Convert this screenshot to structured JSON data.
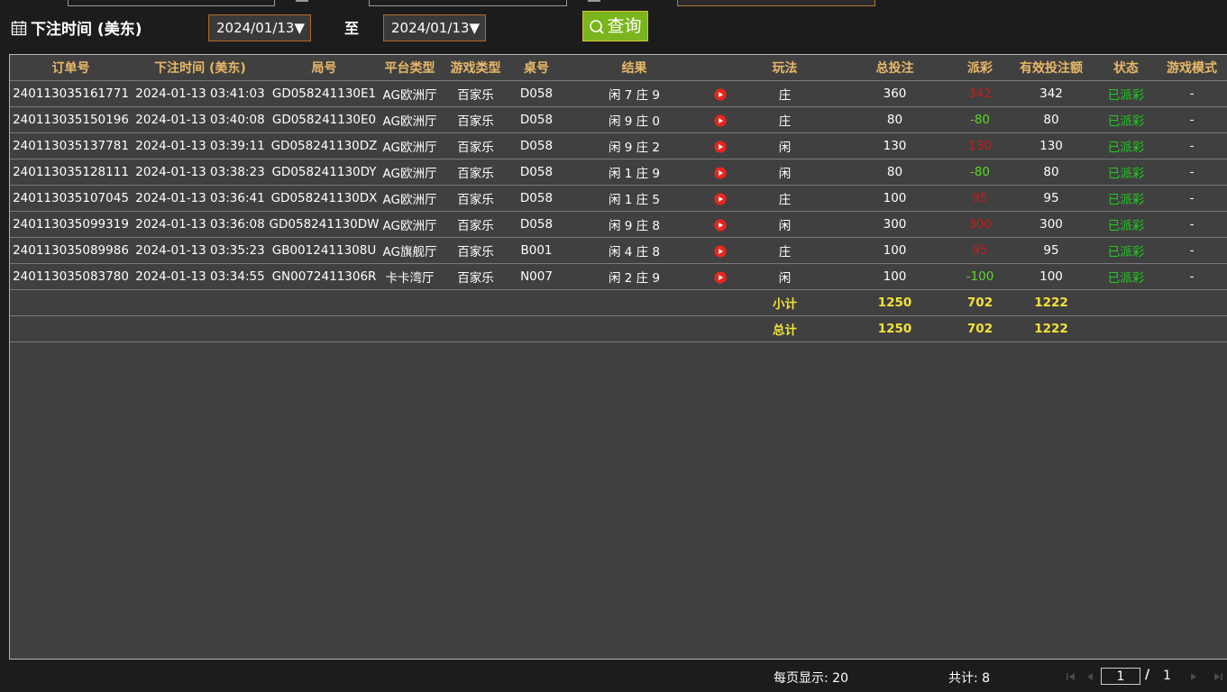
{
  "filters": {
    "label": "下注时间 (美东)",
    "start_date": "2024/01/13▼",
    "to_label": "至",
    "end_date": "2024/01/13▼",
    "query_label": "查询"
  },
  "table": {
    "headers": [
      "订单号",
      "下注时间 (美东)",
      "局号",
      "平台类型",
      "游戏类型",
      "桌号",
      "结果",
      "",
      "玩法",
      "总投注",
      "派彩",
      "有效投注额",
      "状态",
      "游戏模式"
    ],
    "rows": [
      {
        "order": "240113035161771",
        "time": "2024-01-13 03:41:03",
        "round": "GD058241130E1",
        "platform": "AG欧洲厅",
        "game": "百家乐",
        "table_no": "D058",
        "result": "闲 7 庄 9",
        "play": "庄",
        "bet": "360",
        "payout": "342",
        "payout_color": "red",
        "valid": "342",
        "status": "已派彩",
        "mode": "-"
      },
      {
        "order": "240113035150196",
        "time": "2024-01-13 03:40:08",
        "round": "GD058241130E0",
        "platform": "AG欧洲厅",
        "game": "百家乐",
        "table_no": "D058",
        "result": "闲 9 庄 0",
        "play": "庄",
        "bet": "80",
        "payout": "-80",
        "payout_color": "green",
        "valid": "80",
        "status": "已派彩",
        "mode": "-"
      },
      {
        "order": "240113035137781",
        "time": "2024-01-13 03:39:11",
        "round": "GD058241130DZ",
        "platform": "AG欧洲厅",
        "game": "百家乐",
        "table_no": "D058",
        "result": "闲 9 庄 2",
        "play": "闲",
        "bet": "130",
        "payout": "130",
        "payout_color": "red",
        "valid": "130",
        "status": "已派彩",
        "mode": "-"
      },
      {
        "order": "240113035128111",
        "time": "2024-01-13 03:38:23",
        "round": "GD058241130DY",
        "platform": "AG欧洲厅",
        "game": "百家乐",
        "table_no": "D058",
        "result": "闲 1 庄 9",
        "play": "闲",
        "bet": "80",
        "payout": "-80",
        "payout_color": "green",
        "valid": "80",
        "status": "已派彩",
        "mode": "-"
      },
      {
        "order": "240113035107045",
        "time": "2024-01-13 03:36:41",
        "round": "GD058241130DX",
        "platform": "AG欧洲厅",
        "game": "百家乐",
        "table_no": "D058",
        "result": "闲 1 庄 5",
        "play": "庄",
        "bet": "100",
        "payout": "95",
        "payout_color": "red",
        "valid": "95",
        "status": "已派彩",
        "mode": "-"
      },
      {
        "order": "240113035099319",
        "time": "2024-01-13 03:36:08",
        "round": "GD058241130DW",
        "platform": "AG欧洲厅",
        "game": "百家乐",
        "table_no": "D058",
        "result": "闲 9 庄 8",
        "play": "闲",
        "bet": "300",
        "payout": "300",
        "payout_color": "red",
        "valid": "300",
        "status": "已派彩",
        "mode": "-"
      },
      {
        "order": "240113035089986",
        "time": "2024-01-13 03:35:23",
        "round": "GB0012411308U",
        "platform": "AG旗舰厅",
        "game": "百家乐",
        "table_no": "B001",
        "result": "闲 4 庄 8",
        "play": "庄",
        "bet": "100",
        "payout": "95",
        "payout_color": "red",
        "valid": "95",
        "status": "已派彩",
        "mode": "-"
      },
      {
        "order": "240113035083780",
        "time": "2024-01-13 03:34:55",
        "round": "GN0072411306R",
        "platform": "卡卡湾厅",
        "game": "百家乐",
        "table_no": "N007",
        "result": "闲 2 庄 9",
        "play": "闲",
        "bet": "100",
        "payout": "-100",
        "payout_color": "green",
        "valid": "100",
        "status": "已派彩",
        "mode": "-"
      }
    ],
    "subtotal": {
      "label": "小计",
      "bet": "1250",
      "payout": "702",
      "valid": "1222"
    },
    "total": {
      "label": "总计",
      "bet": "1250",
      "payout": "702",
      "valid": "1222"
    }
  },
  "pager": {
    "per_page": "每页显示: 20",
    "total": "共计: 8",
    "current_page": "1",
    "separator": "/",
    "total_pages": "1"
  },
  "colors": {
    "payout_red": "#c81c1c",
    "payout_green": "#5cd62a",
    "status_green": "#22cc22",
    "header_gold": "#e8b868",
    "sum_yellow": "#f2e23a",
    "query_green": "#7ab51d"
  },
  "icons": {
    "calendar": "calendar-icon",
    "query": "search-icon",
    "video": "play-video-icon"
  }
}
